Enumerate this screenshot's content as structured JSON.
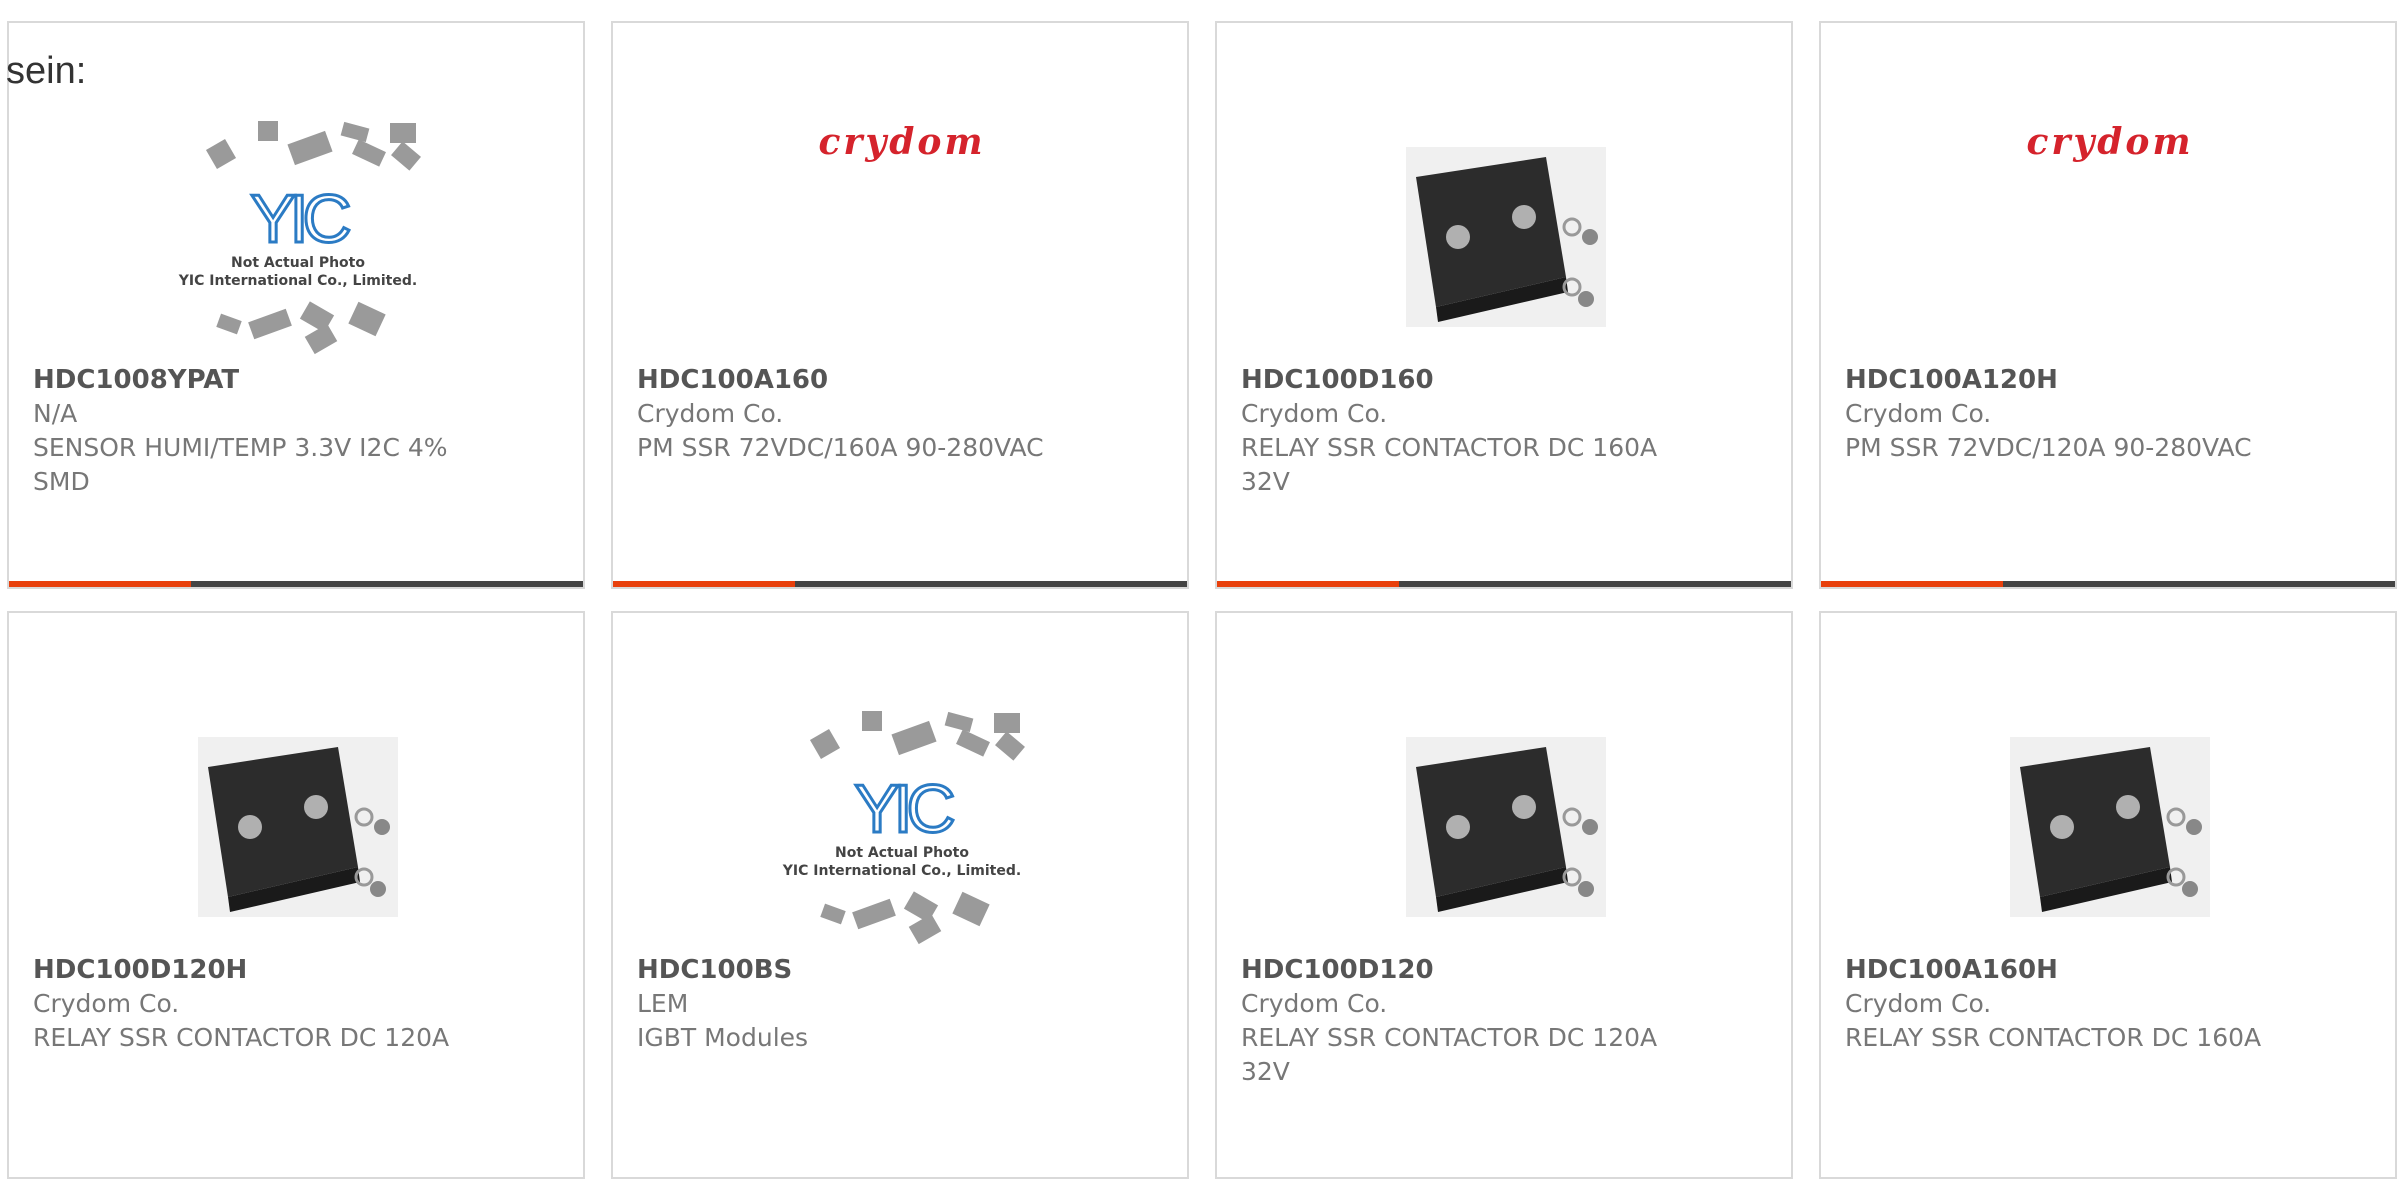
{
  "stray_text": "sein:",
  "placeholder_image": {
    "line1": "Not Actual Photo",
    "line2": "YIC International Co., Limited.",
    "logo": "YIC"
  },
  "brand_logo_text": "crydom",
  "colors": {
    "accent": "#e8400c",
    "bar": "#444444",
    "border": "#d9d9d9",
    "crydom_red": "#d5232c",
    "yic_blue": "#2b7bc4"
  },
  "products": [
    {
      "part": "HDC1008YPAT",
      "maker": "N/A",
      "description": "SENSOR HUMI/TEMP 3.3V I2C 4% SMD",
      "image": "placeholder"
    },
    {
      "part": "HDC100A160",
      "maker": "Crydom Co.",
      "description": "PM SSR 72VDC/160A 90-280VAC",
      "image": "crydom-logo"
    },
    {
      "part": "HDC100D160",
      "maker": "Crydom Co.",
      "description": "RELAY SSR CONTACTOR DC 160A 32V",
      "image": "relay-photo"
    },
    {
      "part": "HDC100A120H",
      "maker": "Crydom Co.",
      "description": "PM SSR 72VDC/120A 90-280VAC",
      "image": "crydom-logo"
    },
    {
      "part": "HDC100D120H",
      "maker": "Crydom Co.",
      "description": "RELAY SSR CONTACTOR DC 120A",
      "image": "relay-photo"
    },
    {
      "part": "HDC100BS",
      "maker": "LEM",
      "description": "IGBT Modules",
      "image": "placeholder"
    },
    {
      "part": "HDC100D120",
      "maker": "Crydom Co.",
      "description": "RELAY SSR CONTACTOR DC 120A 32V",
      "image": "relay-photo"
    },
    {
      "part": "HDC100A160H",
      "maker": "Crydom Co.",
      "description": "RELAY SSR CONTACTOR DC 160A",
      "image": "relay-photo"
    }
  ]
}
